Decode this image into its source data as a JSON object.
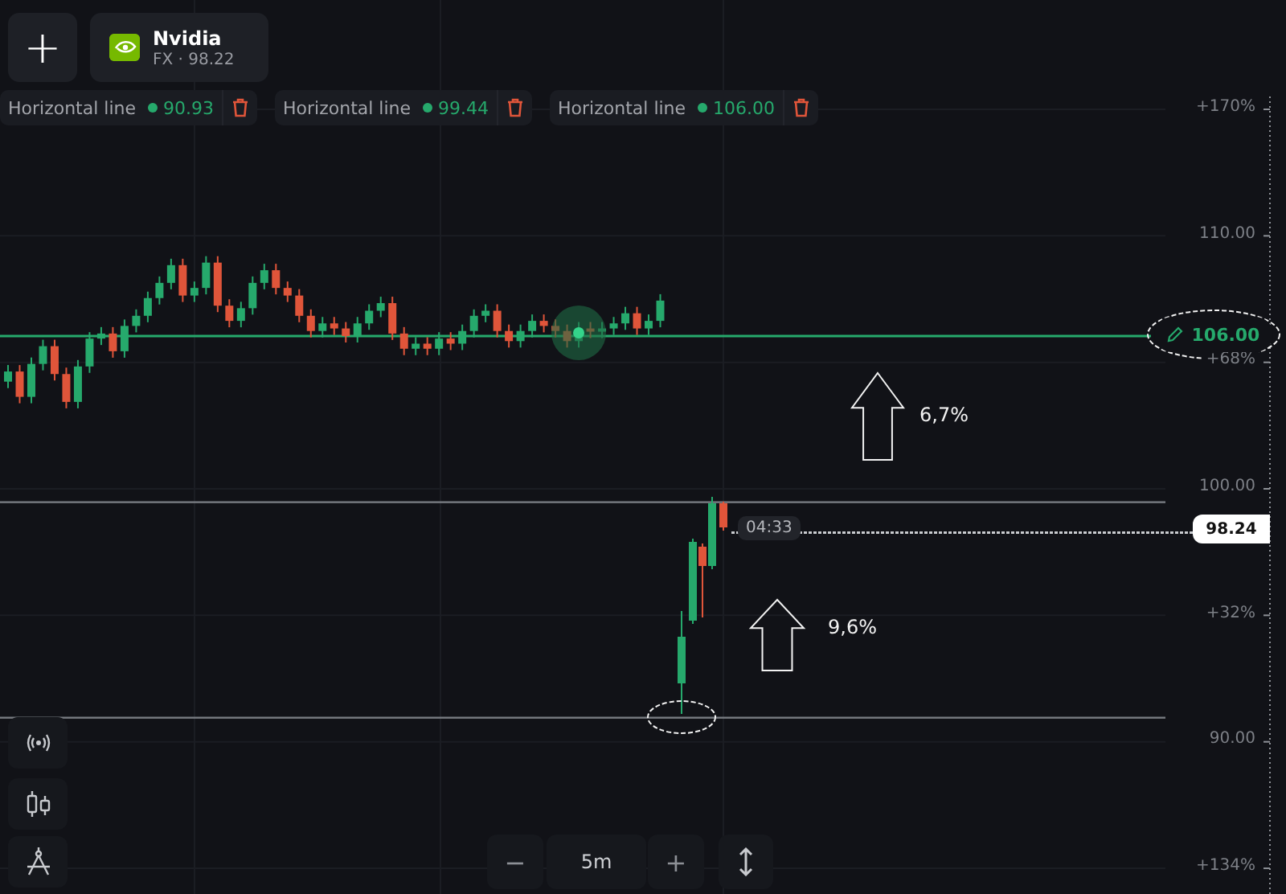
{
  "toolbar": {
    "add_button": "+",
    "instrument": {
      "name": "Nvidia",
      "subtitle": "FX · 98.22"
    }
  },
  "horizontal_lines": [
    {
      "label": "Horizontal line",
      "value": "90.93",
      "selected": false
    },
    {
      "label": "Horizontal line",
      "value": "99.44",
      "selected": false
    },
    {
      "label": "Horizontal line",
      "value": "106.00",
      "selected": true,
      "axis_tag": "106.00"
    }
  ],
  "price_axis": {
    "labels": [
      "+170%",
      "110.00",
      "+68%",
      "100.00",
      "+32%",
      "90.00",
      "+134%"
    ]
  },
  "current_price": {
    "value": "98.24",
    "countdown": "04:33"
  },
  "annotations": [
    {
      "kind": "arrow",
      "text": "6,7%"
    },
    {
      "kind": "arrow",
      "text": "9,6%"
    },
    {
      "kind": "ellipse"
    },
    {
      "kind": "ellipse"
    }
  ],
  "timeframe": {
    "decrease_button": "−",
    "value": "5m",
    "increase_button": "+"
  }
}
